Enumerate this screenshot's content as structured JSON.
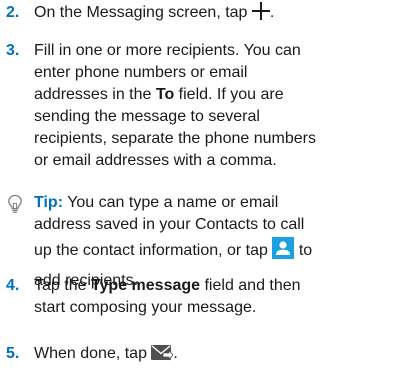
{
  "steps": [
    {
      "number": "2.",
      "text_before": "On the Messaging screen, tap",
      "icon": "plus-icon",
      "text_after": "."
    },
    {
      "number": "3.",
      "line1_a": "Fill in one or more recipients. You can",
      "line2_a": "enter phone numbers or email",
      "line3_a": "addresses in the",
      "line3_bold": "To",
      "line3_b": "field. If you are",
      "line4": "sending the message to several",
      "line5": "recipients, separate the phone numbers",
      "line6": "or email addresses with a comma."
    },
    {
      "label": "Tip:",
      "line1": "You can type a name or email",
      "line2": "address saved in your Contacts to call",
      "line3_a": "up the contact information, or tap",
      "icon": "contact-icon",
      "line3_b": "to",
      "line4": "add recipients."
    },
    {
      "number": "4.",
      "line1_a": "Tap the",
      "line1_bold": "Type message",
      "line1_b": "field and then",
      "line2": "start composing your message."
    },
    {
      "number": "5.",
      "text_before": "When done, tap",
      "icon": "send-icon",
      "text_after": "."
    }
  ],
  "colors": {
    "accent": "#0070c0",
    "contact_icon_bg": "#1ba1e2",
    "tip_icon": "#7f7f7f"
  }
}
